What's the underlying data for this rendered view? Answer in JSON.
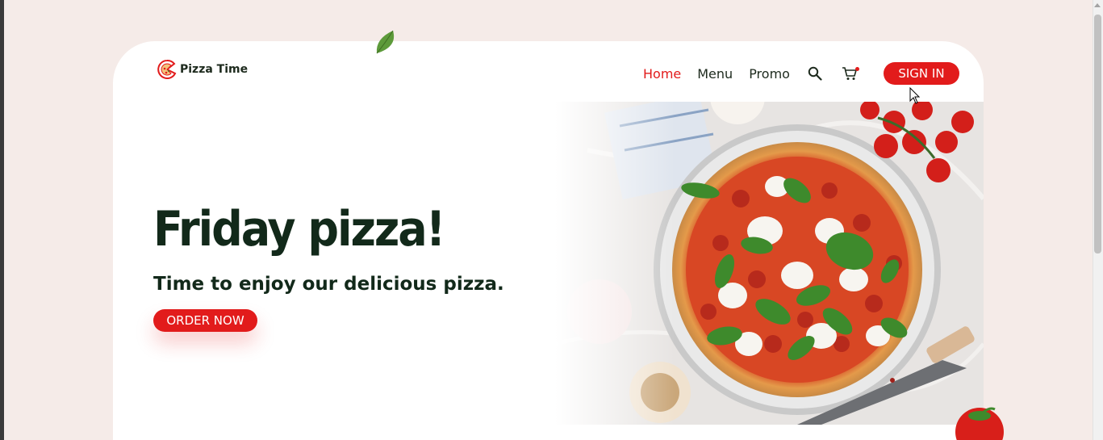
{
  "brand": {
    "name": "Pizza Time"
  },
  "nav": {
    "links": [
      {
        "label": "Home",
        "active": true
      },
      {
        "label": "Menu",
        "active": false
      },
      {
        "label": "Promo",
        "active": false
      }
    ],
    "sign_in_label": "SIGN IN"
  },
  "hero": {
    "title": "Friday pizza!",
    "subtitle": "Time to enjoy our delicious pizza.",
    "cta_label": "ORDER NOW"
  },
  "colors": {
    "accent": "#e21b1b",
    "text_dark": "#12291a",
    "page_bg": "#f5ebe8",
    "card_bg": "#ffffff"
  },
  "icons": [
    "pizza-logo-icon",
    "search-icon",
    "cart-icon",
    "basil-leaf-icon",
    "tomato-icon",
    "cursor-icon"
  ]
}
